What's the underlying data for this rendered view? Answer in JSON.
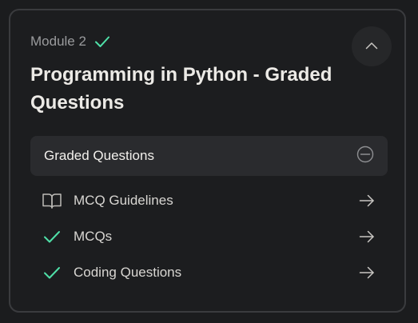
{
  "module": {
    "label": "Module 2",
    "completed_icon": "check-icon",
    "accent_color": "#4fe0a8"
  },
  "header": {
    "title": "Programming in Python - Graded Questions",
    "collapse_icon": "chevron-up-icon"
  },
  "section": {
    "title": "Graded Questions",
    "collapse_icon": "minus-circle-icon"
  },
  "items": [
    {
      "label": "MCQ Guidelines",
      "icon": "book-icon",
      "action_icon": "arrow-right-icon"
    },
    {
      "label": "MCQs",
      "icon": "check-icon",
      "action_icon": "arrow-right-icon"
    },
    {
      "label": "Coding Questions",
      "icon": "check-icon",
      "action_icon": "arrow-right-icon"
    }
  ]
}
